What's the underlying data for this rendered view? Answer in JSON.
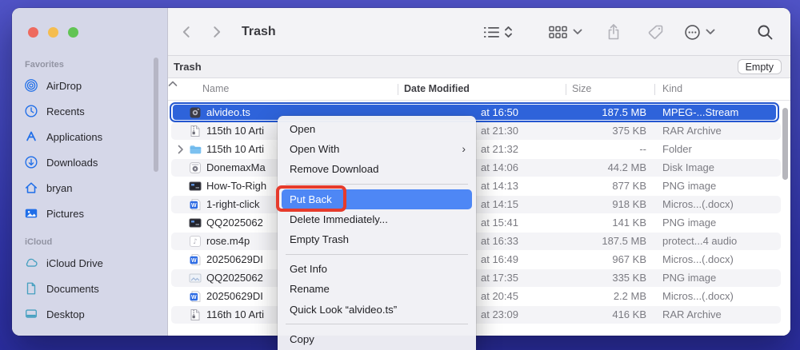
{
  "colors": {
    "accent_blue": "#2e63da",
    "menu_highlight": "#4e87f5",
    "annotation_red": "#e63b2c",
    "sidebar_bg": "#d5d7e8",
    "desktop_top": "#5154c8",
    "desktop_bottom": "#2b2ea0"
  },
  "window": {
    "title": "Trash"
  },
  "toolbar": {
    "title": "Trash",
    "icons": [
      "chevron-left-icon",
      "chevron-right-icon",
      "list-view-icon",
      "sort-chevrons-icon",
      "group-icon",
      "chevron-down-icon",
      "share-icon",
      "tag-icon",
      "more-icon",
      "chevron-down-icon",
      "search-icon"
    ]
  },
  "sidebar": {
    "sections": [
      {
        "label": "Favorites",
        "items": [
          {
            "label": "AirDrop",
            "icon": "airdrop-icon"
          },
          {
            "label": "Recents",
            "icon": "clock-icon"
          },
          {
            "label": "Applications",
            "icon": "applications-icon"
          },
          {
            "label": "Downloads",
            "icon": "downloads-icon"
          },
          {
            "label": "bryan",
            "icon": "home-icon"
          },
          {
            "label": "Pictures",
            "icon": "pictures-icon"
          }
        ]
      },
      {
        "label": "iCloud",
        "items": [
          {
            "label": "iCloud Drive",
            "icon": "cloud-icon"
          },
          {
            "label": "Documents",
            "icon": "document-icon"
          },
          {
            "label": "Desktop",
            "icon": "desktop-icon"
          }
        ]
      }
    ]
  },
  "content": {
    "header": {
      "title": "Trash",
      "empty_button": "Empty"
    },
    "columns": {
      "name": "Name",
      "date": "Date Modified",
      "size": "Size",
      "kind": "Kind",
      "sort_indicator": "ascending"
    },
    "rows": [
      {
        "name": "alvideo.ts",
        "icon": "video-file-icon",
        "date": "at 16:50",
        "size": "187.5 MB",
        "kind": "MPEG-...Stream",
        "selected": true
      },
      {
        "name": "115th 10 Arti",
        "icon": "zip-file-icon",
        "date": "at 21:30",
        "size": "375 KB",
        "kind": "RAR Archive"
      },
      {
        "name": "115th 10 Arti",
        "icon": "folder-icon",
        "date": "at 21:32",
        "size": "--",
        "kind": "Folder",
        "disclosure": true
      },
      {
        "name": "DonemaxMa",
        "icon": "disk-image-icon",
        "date": "at 14:06",
        "size": "44.2 MB",
        "kind": "Disk Image"
      },
      {
        "name": "How-To-Righ",
        "icon": "image-dark-icon",
        "date": "at 14:13",
        "size": "877 KB",
        "kind": "PNG image"
      },
      {
        "name": "1-right-click",
        "icon": "word-file-icon",
        "date": "at 14:15",
        "size": "918 KB",
        "kind": "Micros...(.docx)"
      },
      {
        "name": "QQ2025062",
        "icon": "image-dark-icon",
        "date": "at 15:41",
        "size": "141 KB",
        "kind": "PNG image"
      },
      {
        "name": "rose.m4p",
        "icon": "audio-file-icon",
        "date": "at 16:33",
        "size": "187.5 MB",
        "kind": "protect...4 audio"
      },
      {
        "name": "20250629DI",
        "icon": "word-file-icon",
        "date": "at 16:49",
        "size": "967 KB",
        "kind": "Micros...(.docx)"
      },
      {
        "name": "QQ2025062",
        "icon": "image-light-icon",
        "date": "at 17:35",
        "size": "335 KB",
        "kind": "PNG image"
      },
      {
        "name": "20250629DI",
        "icon": "word-file-icon",
        "date": "at 20:45",
        "size": "2.2 MB",
        "kind": "Micros...(.docx)"
      },
      {
        "name": "116th 10 Arti",
        "icon": "zip-file-icon",
        "date": "at 23:09",
        "size": "416 KB",
        "kind": "RAR Archive"
      }
    ]
  },
  "context_menu": {
    "items": [
      {
        "label": "Open"
      },
      {
        "label": "Open With",
        "submenu": true
      },
      {
        "label": "Remove Download",
        "separator_after": true
      },
      {
        "label": "Put Back",
        "highlighted": true,
        "annotated": true
      },
      {
        "label": "Delete Immediately..."
      },
      {
        "label": "Empty Trash",
        "separator_after": true
      },
      {
        "label": "Get Info"
      },
      {
        "label": "Rename"
      },
      {
        "label": "Quick Look “alvideo.ts”",
        "separator_after": true
      },
      {
        "label": "Copy"
      }
    ]
  }
}
